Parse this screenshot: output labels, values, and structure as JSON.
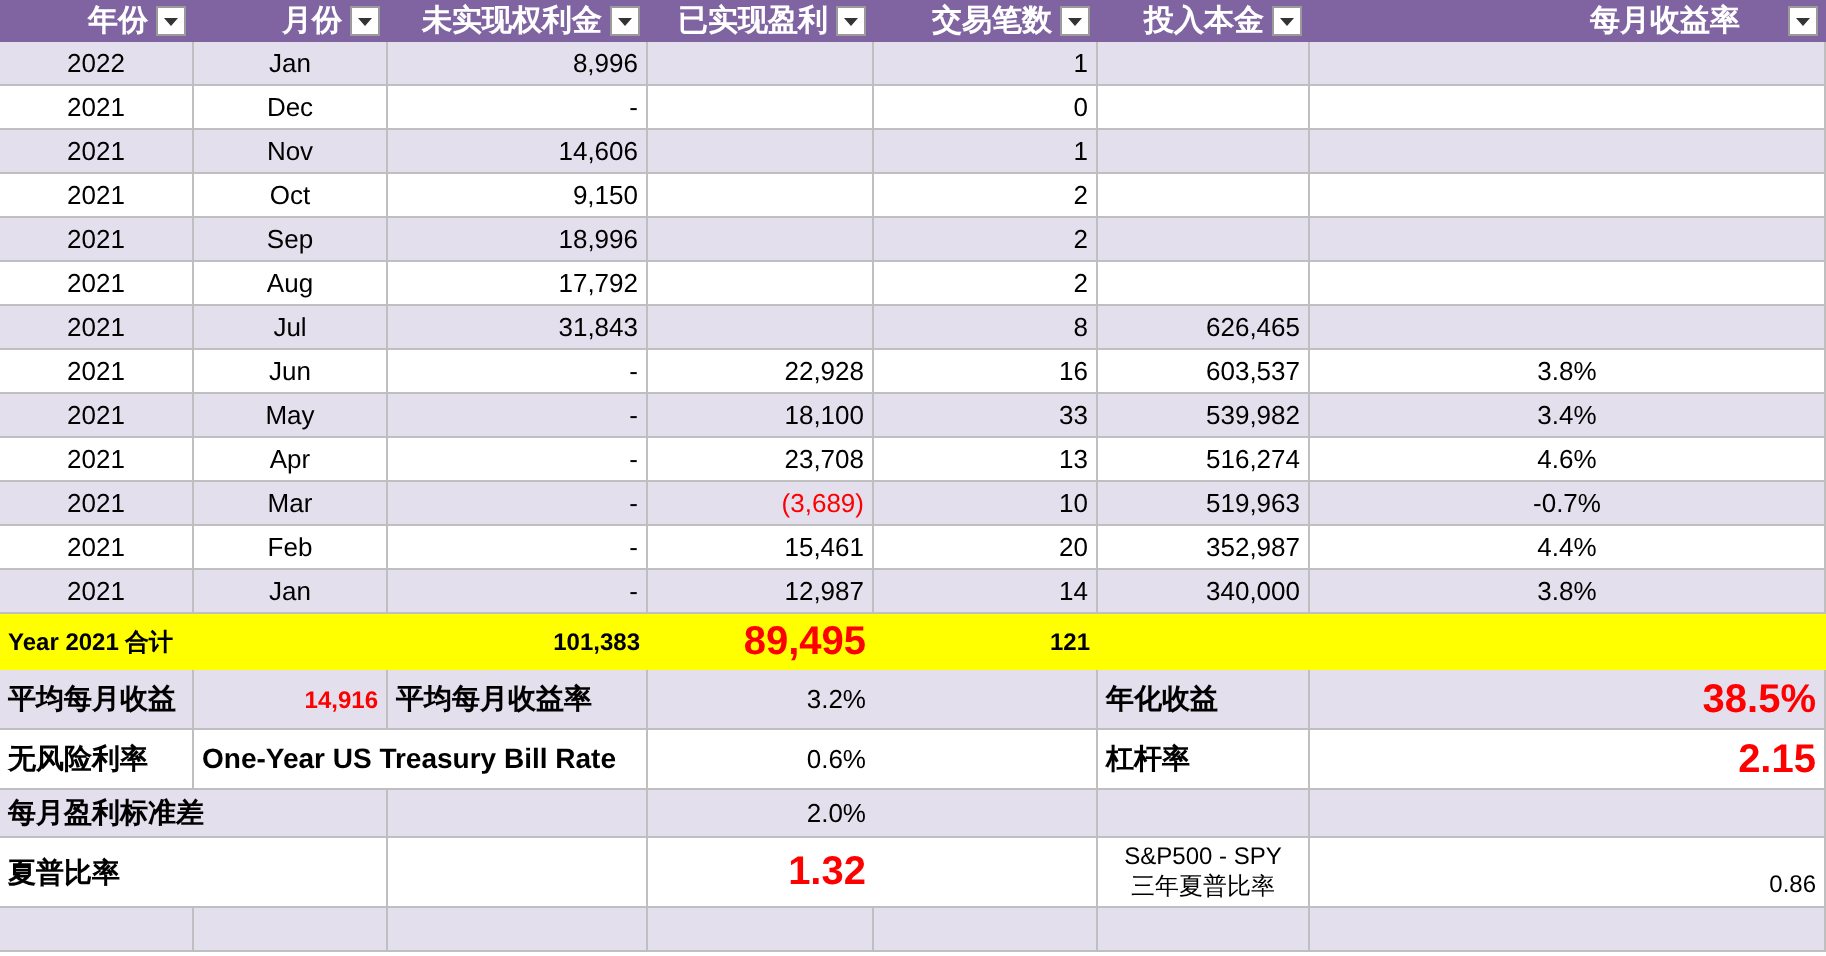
{
  "table": {
    "columns": [
      {
        "label": "年份"
      },
      {
        "label": "月份"
      },
      {
        "label": "未实现权利金"
      },
      {
        "label": "已实现盈利"
      },
      {
        "label": "交易笔数"
      },
      {
        "label": "投入本金"
      },
      {
        "label": "每月收益率"
      }
    ],
    "rows": [
      {
        "year": "2022",
        "month": "Jan",
        "unrealized": "8,996",
        "trades": "1"
      },
      {
        "year": "2021",
        "month": "Dec",
        "unrealized": "-",
        "trades": "0"
      },
      {
        "year": "2021",
        "month": "Nov",
        "unrealized": "14,606",
        "trades": "1"
      },
      {
        "year": "2021",
        "month": "Oct",
        "unrealized": "9,150",
        "trades": "2"
      },
      {
        "year": "2021",
        "month": "Sep",
        "unrealized": "18,996",
        "trades": "2"
      },
      {
        "year": "2021",
        "month": "Aug",
        "unrealized": "17,792",
        "trades": "2"
      },
      {
        "year": "2021",
        "month": "Jul",
        "unrealized": "31,843",
        "trades": "8",
        "capital": "626,465"
      },
      {
        "year": "2021",
        "month": "Jun",
        "unrealized": "-",
        "realized": "22,928",
        "trades": "16",
        "capital": "603,537",
        "monthly_return": "3.8%",
        "loss": false
      },
      {
        "year": "2021",
        "month": "May",
        "unrealized": "-",
        "realized": "18,100",
        "trades": "33",
        "capital": "539,982",
        "monthly_return": "3.4%",
        "loss": false
      },
      {
        "year": "2021",
        "month": "Apr",
        "unrealized": "-",
        "realized": "23,708",
        "trades": "13",
        "capital": "516,274",
        "monthly_return": "4.6%",
        "loss": false
      },
      {
        "year": "2021",
        "month": "Mar",
        "unrealized": "-",
        "realized": "(3,689)",
        "trades": "10",
        "capital": "519,963",
        "monthly_return": "-0.7%",
        "loss": true
      },
      {
        "year": "2021",
        "month": "Feb",
        "unrealized": "-",
        "realized": "15,461",
        "trades": "20",
        "capital": "352,987",
        "monthly_return": "4.4%",
        "loss": false
      },
      {
        "year": "2021",
        "month": "Jan",
        "unrealized": "-",
        "realized": "12,987",
        "trades": "14",
        "capital": "340,000",
        "monthly_return": "3.8%",
        "loss": false
      }
    ],
    "total": {
      "label": "Year 2021 合计",
      "unrealized": "101,383",
      "realized": "89,495",
      "trades": "121"
    }
  },
  "summary": [
    {
      "cells": [
        {
          "kind": "label",
          "text": "平均每月收益"
        },
        {
          "kind": "red_small",
          "text": "14,916"
        },
        {
          "kind": "label",
          "text": "平均每月收益率"
        },
        {
          "kind": "value",
          "text": "3.2%"
        },
        {
          "kind": "empty"
        },
        {
          "kind": "label",
          "text": "年化收益"
        },
        {
          "kind": "red_big",
          "text": "38.5%"
        }
      ]
    },
    {
      "cells": [
        {
          "kind": "label",
          "text": "无风险利率"
        },
        {
          "kind": "label",
          "text": "One-Year US Treasury Bill Rate"
        },
        {
          "kind": "empty"
        },
        {
          "kind": "value",
          "text": "0.6%"
        },
        {
          "kind": "empty"
        },
        {
          "kind": "label",
          "text": "杠杆率"
        },
        {
          "kind": "red_big",
          "text": "2.15"
        }
      ]
    },
    {
      "cells": [
        {
          "kind": "label",
          "text": "每月盈利标准差"
        },
        {
          "kind": "empty"
        },
        {
          "kind": "empty"
        },
        {
          "kind": "value",
          "text": "2.0%"
        },
        {
          "kind": "empty"
        },
        {
          "kind": "empty"
        },
        {
          "kind": "empty"
        }
      ]
    },
    {
      "cells": [
        {
          "kind": "label",
          "text": "夏普比率"
        },
        {
          "kind": "empty"
        },
        {
          "kind": "empty"
        },
        {
          "kind": "red_big",
          "text": "1.32"
        },
        {
          "kind": "empty"
        },
        {
          "kind": "note",
          "lines": [
            "S&P500 - SPY",
            "三年夏普比率"
          ]
        },
        {
          "kind": "value_low",
          "text": "0.86"
        }
      ]
    },
    {
      "cells": [
        {
          "kind": "empty"
        },
        {
          "kind": "empty"
        },
        {
          "kind": "empty"
        },
        {
          "kind": "empty"
        },
        {
          "kind": "empty"
        },
        {
          "kind": "empty"
        },
        {
          "kind": "empty"
        }
      ]
    }
  ]
}
